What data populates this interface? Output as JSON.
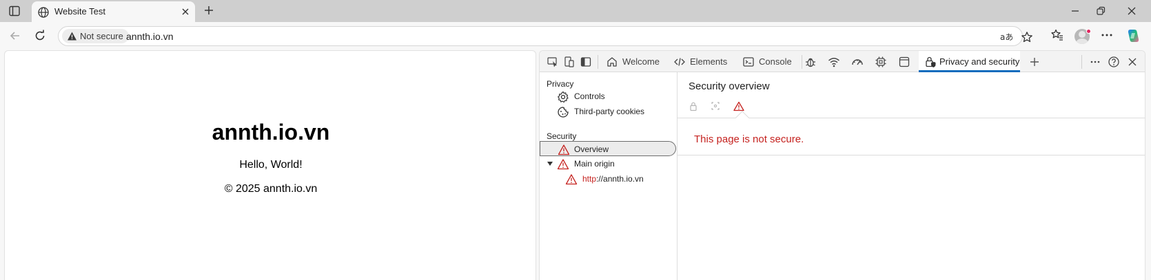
{
  "browser": {
    "tab_title": "Website Test",
    "security_chip": "Not secure",
    "url": "annth.io.vn"
  },
  "page": {
    "heading": "annth.io.vn",
    "greeting": "Hello, World!",
    "footer": "© 2025 annth.io.vn"
  },
  "devtools": {
    "tabs": {
      "welcome": "Welcome",
      "elements": "Elements",
      "console": "Console",
      "privacy_security": "Privacy and security"
    },
    "sidebar": {
      "privacy_heading": "Privacy",
      "controls": "Controls",
      "third_party_cookies": "Third-party cookies",
      "security_heading": "Security",
      "overview": "Overview",
      "main_origin": "Main origin",
      "origin_scheme": "http",
      "origin_rest": "://annth.io.vn"
    },
    "main": {
      "title": "Security overview",
      "message": "This page is not secure."
    }
  },
  "colors": {
    "accent": "#0f6cbd",
    "warning": "#c5221f"
  }
}
